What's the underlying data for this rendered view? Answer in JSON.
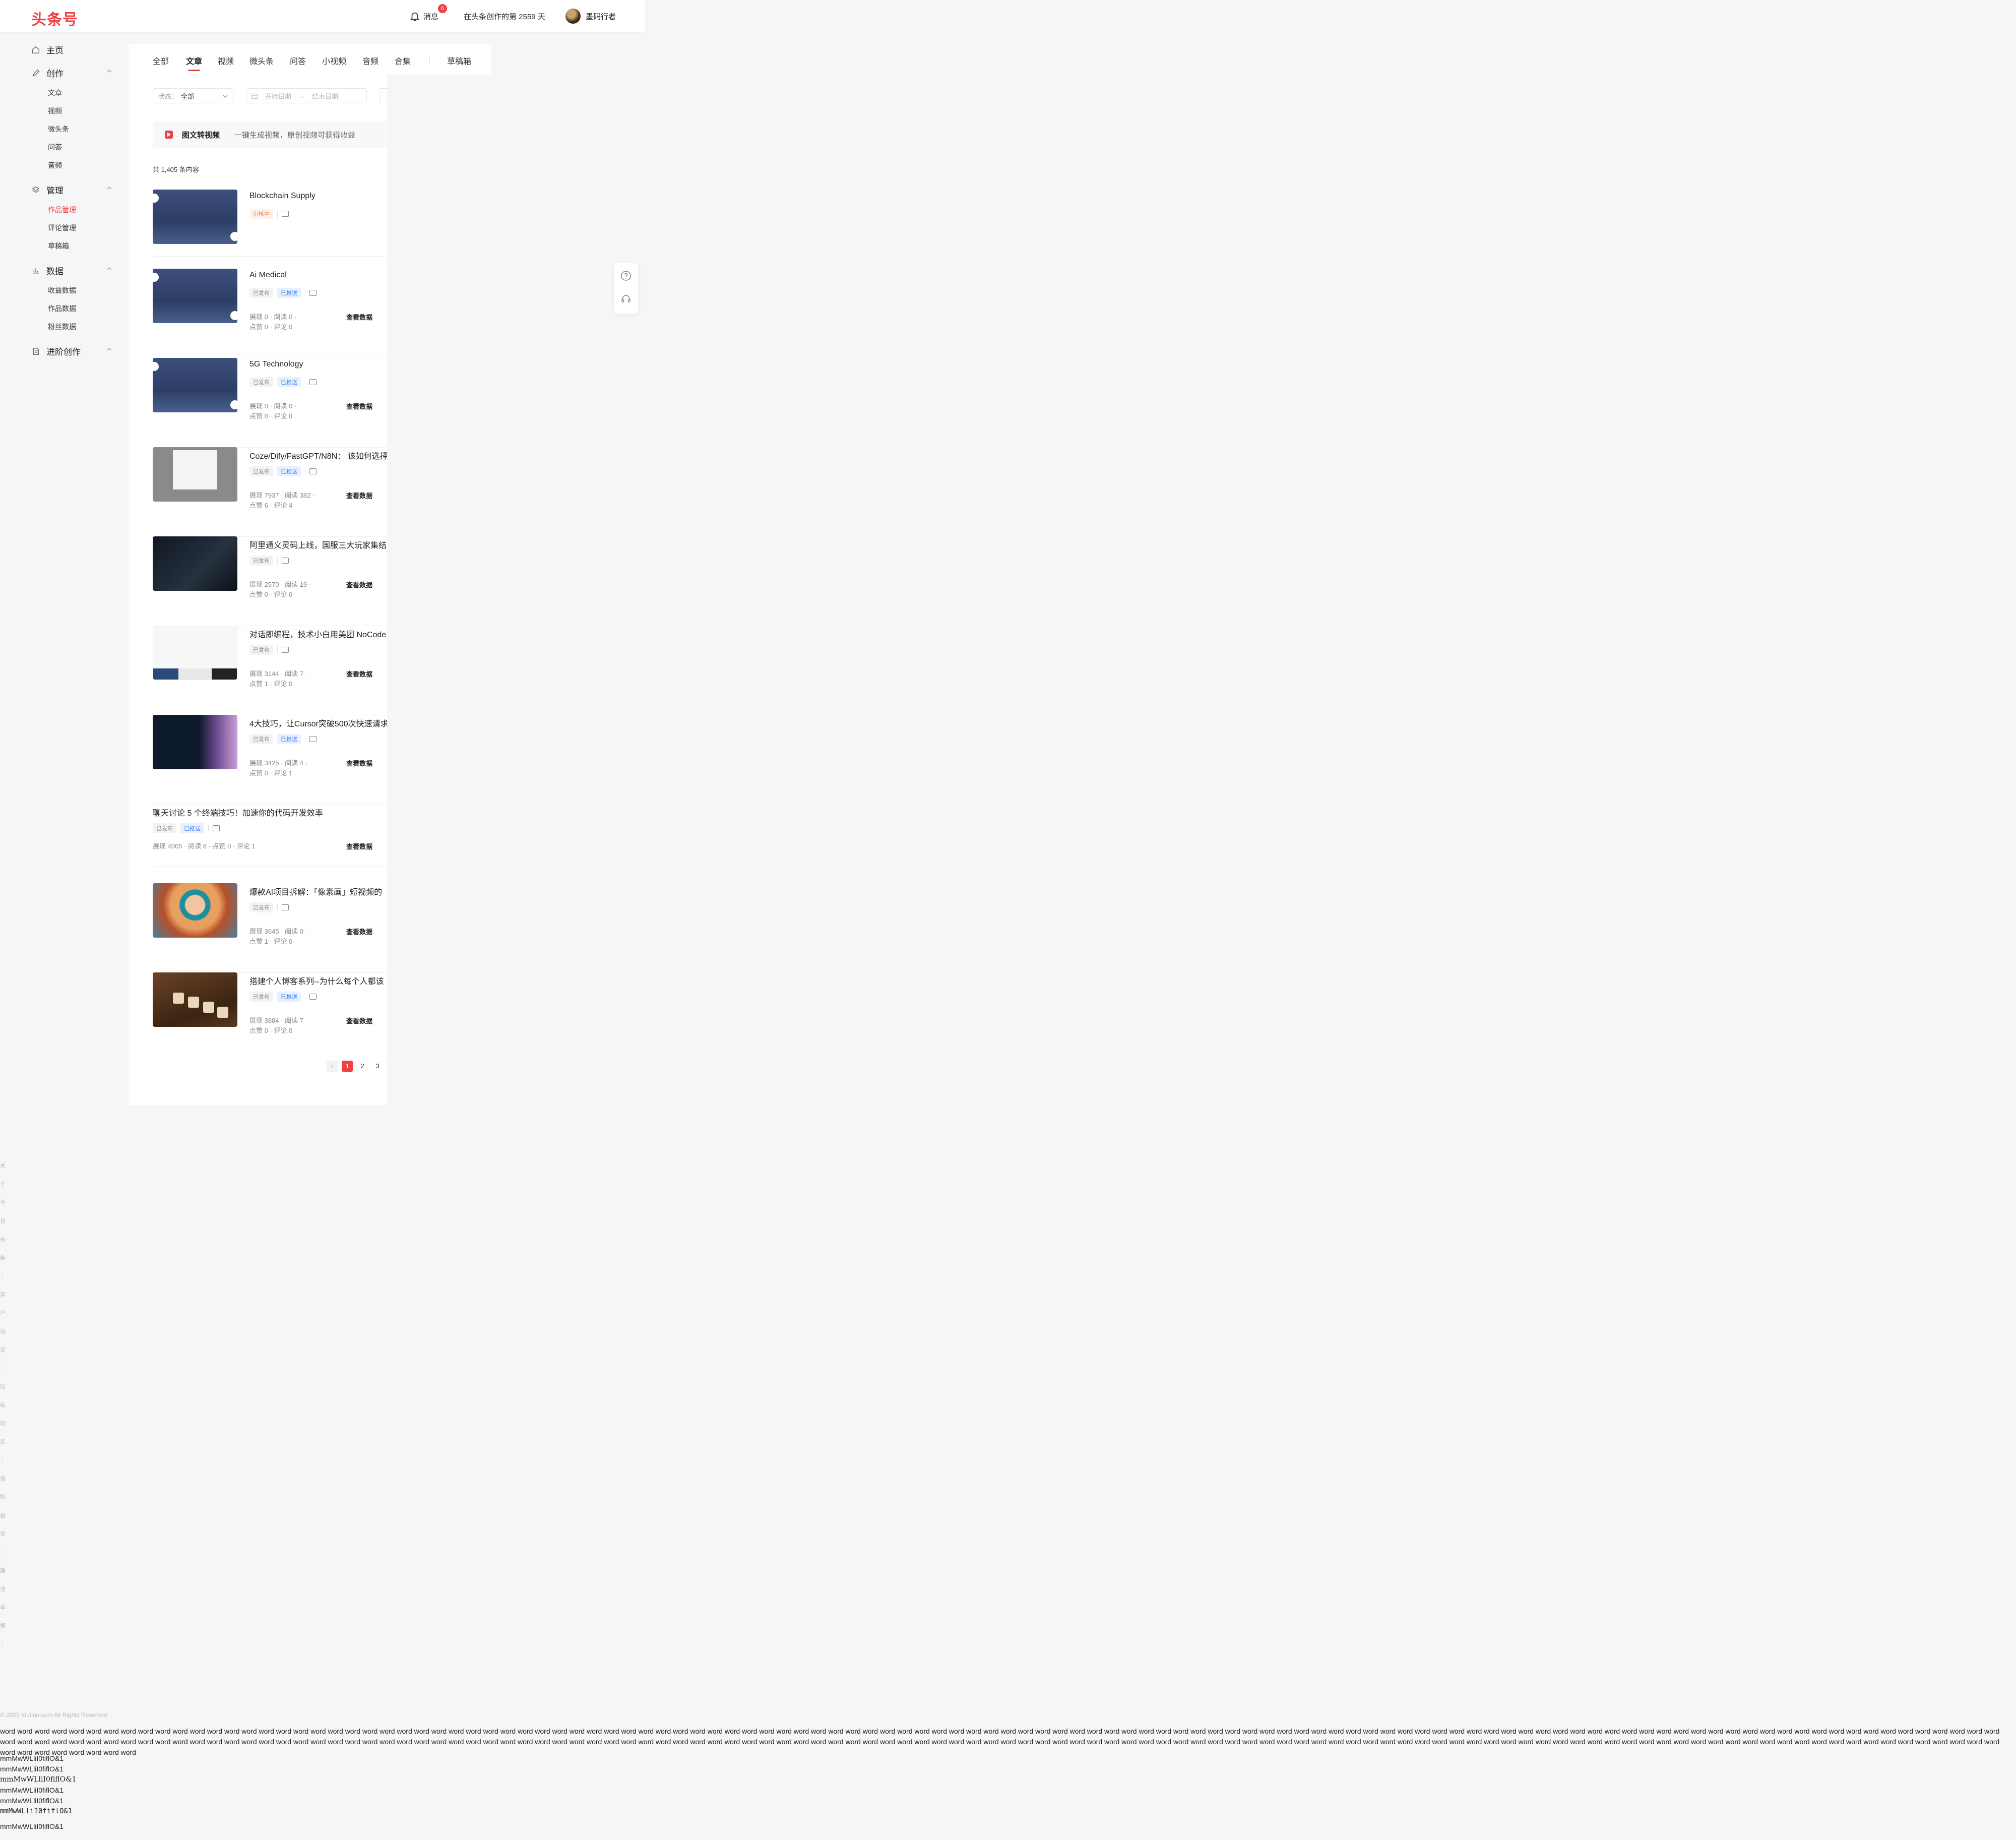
{
  "header": {
    "logo": "头条号",
    "message_label": "消息",
    "message_badge": "6",
    "days_text": "在头条创作的第 2559 天",
    "username": "墨码行者"
  },
  "sidebar": {
    "home": "主页",
    "create": "创作",
    "create_items": [
      "文章",
      "视频",
      "微头条",
      "问答",
      "音频"
    ],
    "manage": "管理",
    "manage_items": [
      "作品管理",
      "评论管理",
      "草稿箱"
    ],
    "data": "数据",
    "data_items": [
      "收益数据",
      "作品数据",
      "粉丝数据"
    ],
    "advanced": "进阶创作"
  },
  "tabs": [
    "全部",
    "文章",
    "视频",
    "微头条",
    "问答",
    "小视频",
    "音频",
    "合集",
    "草稿箱"
  ],
  "active_tab": "文章",
  "filters": {
    "status_label": "状态：",
    "status_value": "全部",
    "start_placeholder": "开始日期",
    "end_placeholder": "结束日期",
    "range_sep": "→"
  },
  "banner": {
    "title": "图文转视频",
    "desc": "一键生成视频，原创视频可获得收益"
  },
  "count_text": "共 1,405 条内容",
  "view_data_label": "查看数据",
  "items": [
    {
      "title": "Blockchain Supply",
      "tags": [
        "审核中"
      ]
    },
    {
      "title": "Ai Medical",
      "tags": [
        "已发布",
        "已推送"
      ],
      "stats1": "展现 0  ·  阅读 0  ·",
      "stats2": "点赞 0  ·  评论 0"
    },
    {
      "title": "5G Technology",
      "tags": [
        "已发布",
        "已推送"
      ],
      "stats1": "展现 0  ·  阅读 0  ·",
      "stats2": "点赞 0  ·  评论 0"
    },
    {
      "title": "Coze/Dify/FastGPT/N8N： 该如何选择",
      "tags": [
        "已发布",
        "已推送"
      ],
      "stats1": "展现 7937  ·  阅读 382  ·",
      "stats2": "点赞 6  ·  评论 4"
    },
    {
      "title": "阿里通义灵码上线，国服三大玩家集结",
      "tags": [
        "已发布"
      ],
      "stats1": "展现 2570  ·  阅读 19  ·",
      "stats2": "点赞 0  ·  评论 0"
    },
    {
      "title": "对话即编程，技术小白用美团 NoCode",
      "tags": [
        "已发布"
      ],
      "stats1": "展现 3144  ·  阅读 7  ·",
      "stats2": "点赞 1  ·  评论 0"
    },
    {
      "title": "4大技巧，让Cursor突破500次快速请求",
      "tags": [
        "已发布",
        "已推送"
      ],
      "stats1": "展现 3425  ·  阅读 4  ·",
      "stats2": "点赞 0  ·  评论 1"
    },
    {
      "title": "聊天讨论 5 个终端技巧！加速你的代码开发效率",
      "tags": [
        "已发布",
        "已推送"
      ],
      "stats1": "展现 4005  ·  阅读 6  ·  点赞 0  ·  评论 1"
    },
    {
      "title": "爆款AI项目拆解：「像素画」短视频的",
      "tags": [
        "已发布"
      ],
      "stats1": "展现 3645  ·  阅读 0  ·",
      "stats2": "点赞 1  ·  评论 0"
    },
    {
      "title": "搭建个人博客系列--为什么每个人都该",
      "tags": [
        "已发布",
        "已推送"
      ],
      "stats1": "展现 3884  ·  阅读 7  ·",
      "stats2": "点赞 0  ·  评论 0"
    }
  ],
  "pagination": {
    "prev": "‹",
    "pages": [
      "1",
      "2",
      "3"
    ]
  },
  "footer": {
    "vertical_text": "关于今日头条｜用户协议｜隐私政策｜侵权投诉｜廉洁举报｜",
    "copyright": "© 2025 toutiao.com All Rights Reserved",
    "probe_text": "mmMwWLliI0fiflO&1"
  },
  "icons": {
    "home": "home-icon",
    "create": "pen-icon",
    "manage": "layers-icon",
    "data": "chart-icon",
    "advanced": "doc-icon",
    "bell": "bell-icon",
    "help": "question-icon",
    "service": "headset-icon"
  },
  "colors": {
    "accent": "#f04142",
    "push": "#3d7cf0",
    "pending": "#f07a3c"
  }
}
